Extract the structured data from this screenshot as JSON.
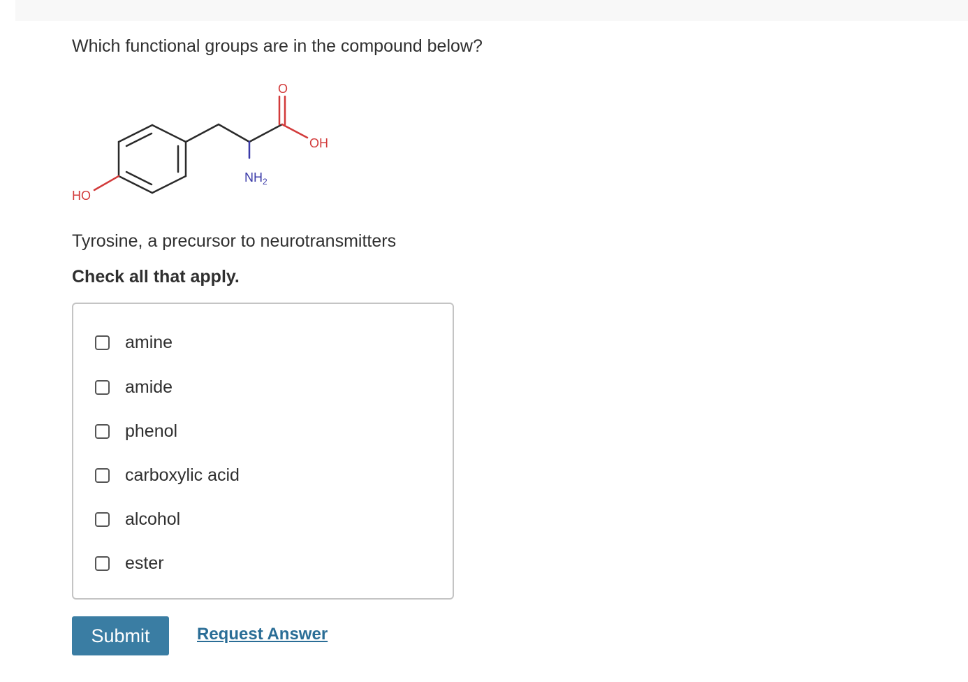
{
  "question": "Which functional groups are in the compound below?",
  "molecule": {
    "labels": {
      "carbonyl_o": "O",
      "oh": "OH",
      "nh2_main": "NH",
      "nh2_sub": "2",
      "ho": "HO"
    },
    "colors": {
      "bond": "#2a2a2a",
      "oxygen": "#d23a3a",
      "nitrogen": "#3a3aa8"
    }
  },
  "caption": "Tyrosine, a precursor to neurotransmitters",
  "instruction": "Check all that apply.",
  "options": [
    {
      "label": "amine",
      "checked": false
    },
    {
      "label": "amide",
      "checked": false
    },
    {
      "label": "phenol",
      "checked": false
    },
    {
      "label": "carboxylic acid",
      "checked": false
    },
    {
      "label": "alcohol",
      "checked": false
    },
    {
      "label": "ester",
      "checked": false
    }
  ],
  "actions": {
    "submit_label": "Submit",
    "request_answer_label": "Request Answer"
  },
  "colors": {
    "submit_bg": "#3a7da3",
    "link": "#2a6d96"
  }
}
